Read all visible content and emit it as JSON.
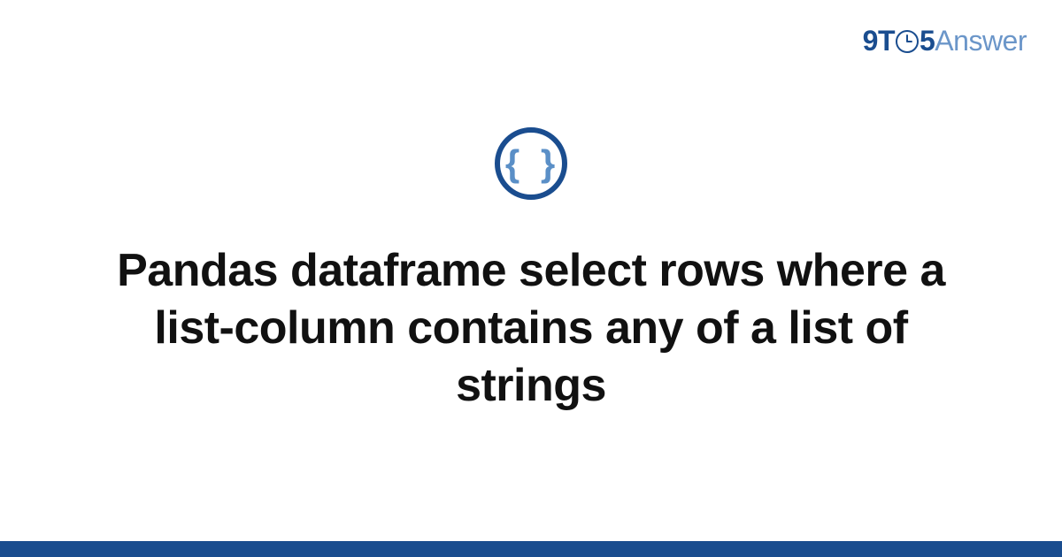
{
  "logo": {
    "nine": "9",
    "t": "T",
    "five": "5",
    "answer": "Answer"
  },
  "icon": {
    "name": "code-braces-icon",
    "glyph": "{ }"
  },
  "title": "Pandas dataframe select rows where a list-column contains any of a list of strings",
  "colors": {
    "brand_dark": "#1a4d8f",
    "brand_light": "#6b96c9",
    "brace_blue": "#5a8fc7"
  }
}
